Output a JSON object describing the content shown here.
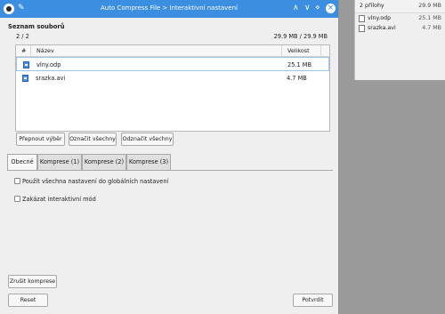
{
  "titlebar": {
    "title": "Auto Compress File > Interaktivní nastavení",
    "pin": "✎",
    "minimize": "∧",
    "collapse": "∨",
    "maximize": "⋄",
    "close": "×"
  },
  "files": {
    "section_title": "Seznam souborů",
    "count": "2 / 2",
    "total": "29.9 MB / 29.9 MB",
    "columns": {
      "index": "#",
      "name": "Název",
      "size": "Velikost"
    },
    "rows": [
      {
        "name": "vlny.odp",
        "size": "25.1 MB"
      },
      {
        "name": "srazka.avi",
        "size": "4.7 MB"
      }
    ]
  },
  "selection": {
    "invert": "Přepnout výběr",
    "select_all": "Označit všechny",
    "deselect_all": "Odznačit všechny"
  },
  "tabs": [
    "Obecné",
    "Komprese (1)",
    "Komprese (2)",
    "Komprese (3)"
  ],
  "general": {
    "use_global": "Použít všechna nastavení do globálních nastavení",
    "disable_interactive": "Zakázat interaktivní mód"
  },
  "footer": {
    "cancel_compression": "Zrušit komprese",
    "reset": "Reset",
    "confirm": "Potvrdit"
  },
  "background": {
    "title": "2 přílohy",
    "total": "29.9 MB",
    "items": [
      {
        "name": "vlny.odp",
        "size": "25.1 MB"
      },
      {
        "name": "srazka.avi",
        "size": "4.7 MB"
      }
    ]
  }
}
